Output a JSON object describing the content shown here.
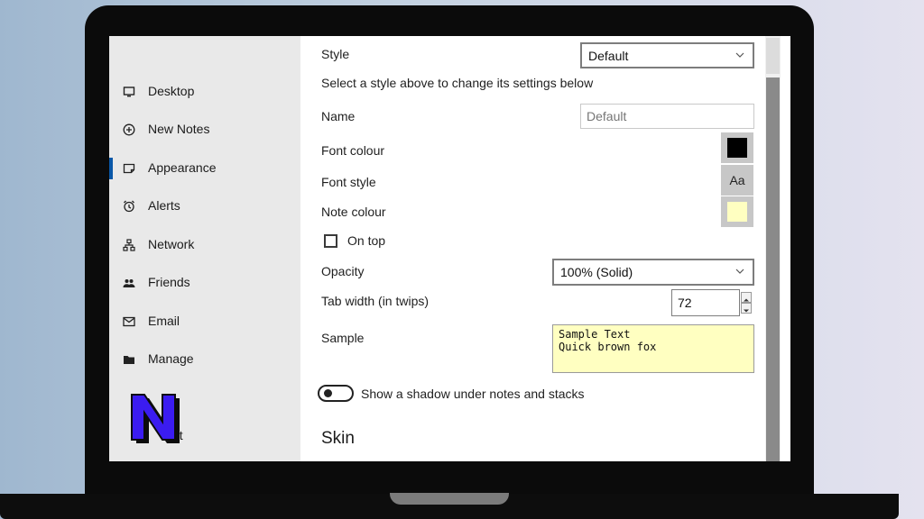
{
  "sidebar": {
    "items": [
      {
        "label": "Desktop",
        "icon": "monitor-icon"
      },
      {
        "label": "New Notes",
        "icon": "plus-circle-icon"
      },
      {
        "label": "Appearance",
        "icon": "note-icon",
        "active": true
      },
      {
        "label": "Alerts",
        "icon": "alarm-clock-icon"
      },
      {
        "label": "Network",
        "icon": "network-icon"
      },
      {
        "label": "Friends",
        "icon": "people-icon"
      },
      {
        "label": "Email",
        "icon": "envelope-icon"
      },
      {
        "label": "Manage",
        "icon": "folder-icon"
      }
    ],
    "partial_item_label": "nt"
  },
  "logo": {
    "text": "N",
    "color": "#3b1cf0"
  },
  "appearance": {
    "style_label": "Style",
    "style_value": "Default",
    "style_hint": "Select a style above to change its settings below",
    "name_label": "Name",
    "name_placeholder": "Default",
    "font_colour_label": "Font colour",
    "font_colour": "#000000",
    "font_style_label": "Font style",
    "font_style_button": "Aa",
    "note_colour_label": "Note colour",
    "note_colour": "#ffffc1",
    "on_top_label": "On top",
    "on_top_checked": false,
    "opacity_label": "Opacity",
    "opacity_value": "100% (Solid)",
    "tab_width_label": "Tab width (in twips)",
    "tab_width_value": "72",
    "sample_label": "Sample",
    "sample_line1": "Sample Text",
    "sample_line2": "Quick brown fox",
    "shadow_label": "Show a shadow under notes and stacks",
    "shadow_on": false,
    "skin_heading": "Skin"
  },
  "colors": {
    "accent": "#0a58a8",
    "sidebar_bg": "#e9e9e9",
    "note_yellow": "#ffffc1"
  }
}
